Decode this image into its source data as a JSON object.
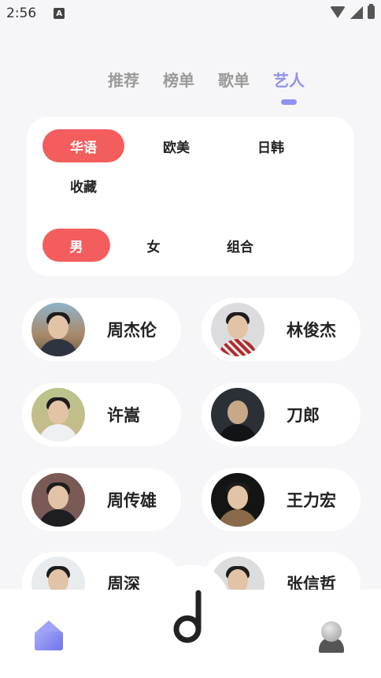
{
  "status_bar": {
    "time": "2:56",
    "notification_letter": "A"
  },
  "tabs": [
    {
      "label": "推荐",
      "active": false
    },
    {
      "label": "榜单",
      "active": false
    },
    {
      "label": "歌单",
      "active": false
    },
    {
      "label": "艺人",
      "active": true
    }
  ],
  "filters": {
    "region": [
      "华语",
      "欧美",
      "日韩",
      "收藏"
    ],
    "region_selected": "华语",
    "type": [
      "男",
      "女",
      "组合"
    ],
    "type_selected": "男"
  },
  "artists": [
    {
      "name": "周杰伦"
    },
    {
      "name": "林俊杰"
    },
    {
      "name": "许嵩"
    },
    {
      "name": "刀郎"
    },
    {
      "name": "周传雄"
    },
    {
      "name": "王力宏"
    },
    {
      "name": "周深"
    },
    {
      "name": "张信哲"
    }
  ],
  "colors": {
    "accent": "#8f93ee",
    "chip_active": "#f35d5d",
    "background": "#f6f6f8"
  },
  "bottom_nav": {
    "icons": [
      "home-icon",
      "music-logo-icon",
      "user-icon"
    ]
  }
}
